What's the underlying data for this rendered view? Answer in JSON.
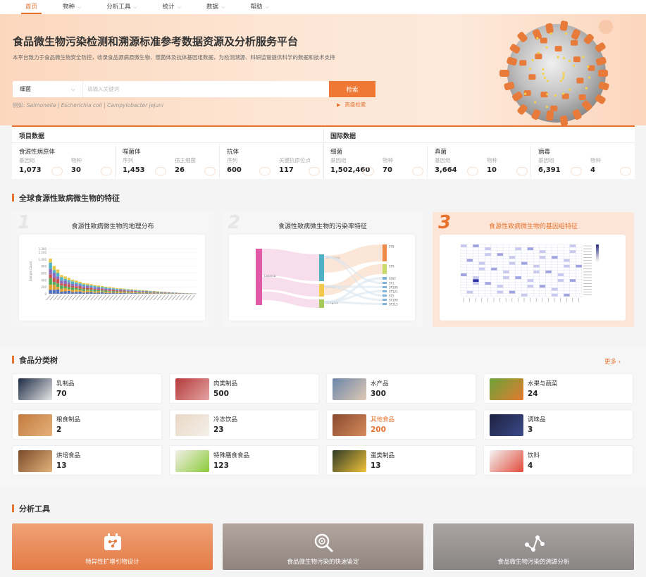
{
  "nav": {
    "items": [
      {
        "label": "首页",
        "active": true,
        "has_dropdown": false
      },
      {
        "label": "物种",
        "active": false,
        "has_dropdown": true
      },
      {
        "label": "分析工具",
        "active": false,
        "has_dropdown": true
      },
      {
        "label": "统计",
        "active": false,
        "has_dropdown": true
      },
      {
        "label": "数据",
        "active": false,
        "has_dropdown": true
      },
      {
        "label": "帮助",
        "active": false,
        "has_dropdown": true
      }
    ],
    "dropdown_icon": "chevron-down-icon"
  },
  "hero": {
    "title": "食品微生物污染检测和溯源标准参考数据资源及分析服务平台",
    "description": "本平台致力于食品微生物安全防控，收录食品源病原微生物、噬菌体及抗体基因组数据，为检测溯源、科研监管提供科学的数据和技术支持",
    "search": {
      "category": "细菌",
      "placeholder": "请输入关键词",
      "button": "检索"
    },
    "example_prefix": "例如: ",
    "examples": [
      "Salmonella",
      "Escherichia coli",
      "Campylobacter jejuni"
    ],
    "example_sep": " | ",
    "advanced_search": "高级检索"
  },
  "stats": {
    "project_title": "项目数据",
    "intl_title": "国际数据",
    "groups": [
      {
        "title": "食源性病原体",
        "cells": [
          {
            "label": "基因组",
            "value": "1,073"
          },
          {
            "label": "物种",
            "value": "30"
          }
        ]
      },
      {
        "title": "噬菌体",
        "cells": [
          {
            "label": "序列",
            "value": "1,453"
          },
          {
            "label": "宿主细菌",
            "value": "26"
          }
        ]
      },
      {
        "title": "抗体",
        "cells": [
          {
            "label": "序列",
            "value": "600"
          },
          {
            "label": "关键抗原位点",
            "value": "117"
          }
        ]
      },
      {
        "title": "细菌",
        "cells": [
          {
            "label": "基因组",
            "value": "1,502,460"
          },
          {
            "label": "物种",
            "value": "70"
          }
        ]
      },
      {
        "title": "真菌",
        "cells": [
          {
            "label": "基因组",
            "value": "3,664"
          },
          {
            "label": "物种",
            "value": "10"
          }
        ]
      },
      {
        "title": "病毒",
        "cells": [
          {
            "label": "基因组",
            "value": "6,391"
          },
          {
            "label": "物种",
            "value": "4"
          }
        ]
      }
    ]
  },
  "features": {
    "section_title": "全球食源性致病微生物的特征",
    "cards": [
      {
        "num": "1",
        "title": "食源性致病微生物的地理分布",
        "active": false
      },
      {
        "num": "2",
        "title": "食源性致病微生物的污染率特征",
        "active": false
      },
      {
        "num": "3",
        "title": "食源性致病微生物的基因组特征",
        "active": true
      }
    ]
  },
  "chart_data": [
    {
      "type": "bar",
      "ylim": [
        0,
        1300
      ],
      "yticks": [
        "1,300",
        "1,200",
        "1,000",
        "800",
        "600",
        "400",
        "200",
        "0"
      ],
      "ylabel": "Sample Count",
      "series_colors": [
        "#4c6fbf",
        "#e0a030",
        "#55aa55",
        "#c85450",
        "#8a6bbf",
        "#4fb0c6",
        "#e6c84a"
      ],
      "values": [
        1050,
        800,
        700,
        560,
        500,
        460,
        420,
        380,
        350,
        320,
        300,
        280,
        260,
        240,
        225,
        210,
        195,
        180,
        170,
        160,
        150,
        140,
        130,
        120,
        112,
        105,
        98,
        90,
        82,
        75,
        68,
        60,
        52,
        45,
        38,
        30,
        25,
        20,
        15,
        10
      ]
    },
    {
      "type": "sankey",
      "source": [
        "Listeria"
      ],
      "middle": [
        "Zhejiang",
        "Anhui",
        "Ningxia"
      ],
      "targets": [
        "ST8",
        "ST9",
        "ST87",
        "ST1",
        "ST299",
        "ST121",
        "ST5",
        "ST199",
        "ST315"
      ]
    },
    {
      "type": "heatmap"
    }
  ],
  "food": {
    "section_title": "食品分类树",
    "more": "更多",
    "items": [
      {
        "name": "乳制品",
        "count": "70",
        "icon": "milk-icon",
        "highlight": false
      },
      {
        "name": "肉类制品",
        "count": "500",
        "icon": "meat-icon",
        "highlight": false
      },
      {
        "name": "水产品",
        "count": "300",
        "icon": "fish-icon",
        "highlight": false
      },
      {
        "name": "水果与蔬菜",
        "count": "24",
        "icon": "vegetable-icon",
        "highlight": false
      },
      {
        "name": "粮食制品",
        "count": "2",
        "icon": "cookie-icon",
        "highlight": false
      },
      {
        "name": "冷冻饮品",
        "count": "23",
        "icon": "icecream-icon",
        "highlight": false
      },
      {
        "name": "其他食品",
        "count": "200",
        "icon": "chocolate-icon",
        "highlight": true
      },
      {
        "name": "调味品",
        "count": "3",
        "icon": "sauce-bottle-icon",
        "highlight": false
      },
      {
        "name": "烘培食品",
        "count": "13",
        "icon": "cake-icon",
        "highlight": false
      },
      {
        "name": "特殊膳食食品",
        "count": "123",
        "icon": "juice-icon",
        "highlight": false
      },
      {
        "name": "蛋类制品",
        "count": "13",
        "icon": "egg-icon",
        "highlight": false
      },
      {
        "name": "饮料",
        "count": "4",
        "icon": "drink-icon",
        "highlight": false
      }
    ]
  },
  "tools": {
    "section_title": "分析工具",
    "items": [
      {
        "label": "特异性扩增引物设计",
        "icon": "primer-design-icon",
        "color": "#e8834f"
      },
      {
        "label": "食品微生物污染的快速鉴定",
        "icon": "magnify-bacteria-icon",
        "color": "#9a8f89"
      },
      {
        "label": "食品微生物污染的溯源分析",
        "icon": "network-icon",
        "color": "#8e8a8a"
      }
    ]
  },
  "colors": {
    "accent": "#e8732f"
  }
}
